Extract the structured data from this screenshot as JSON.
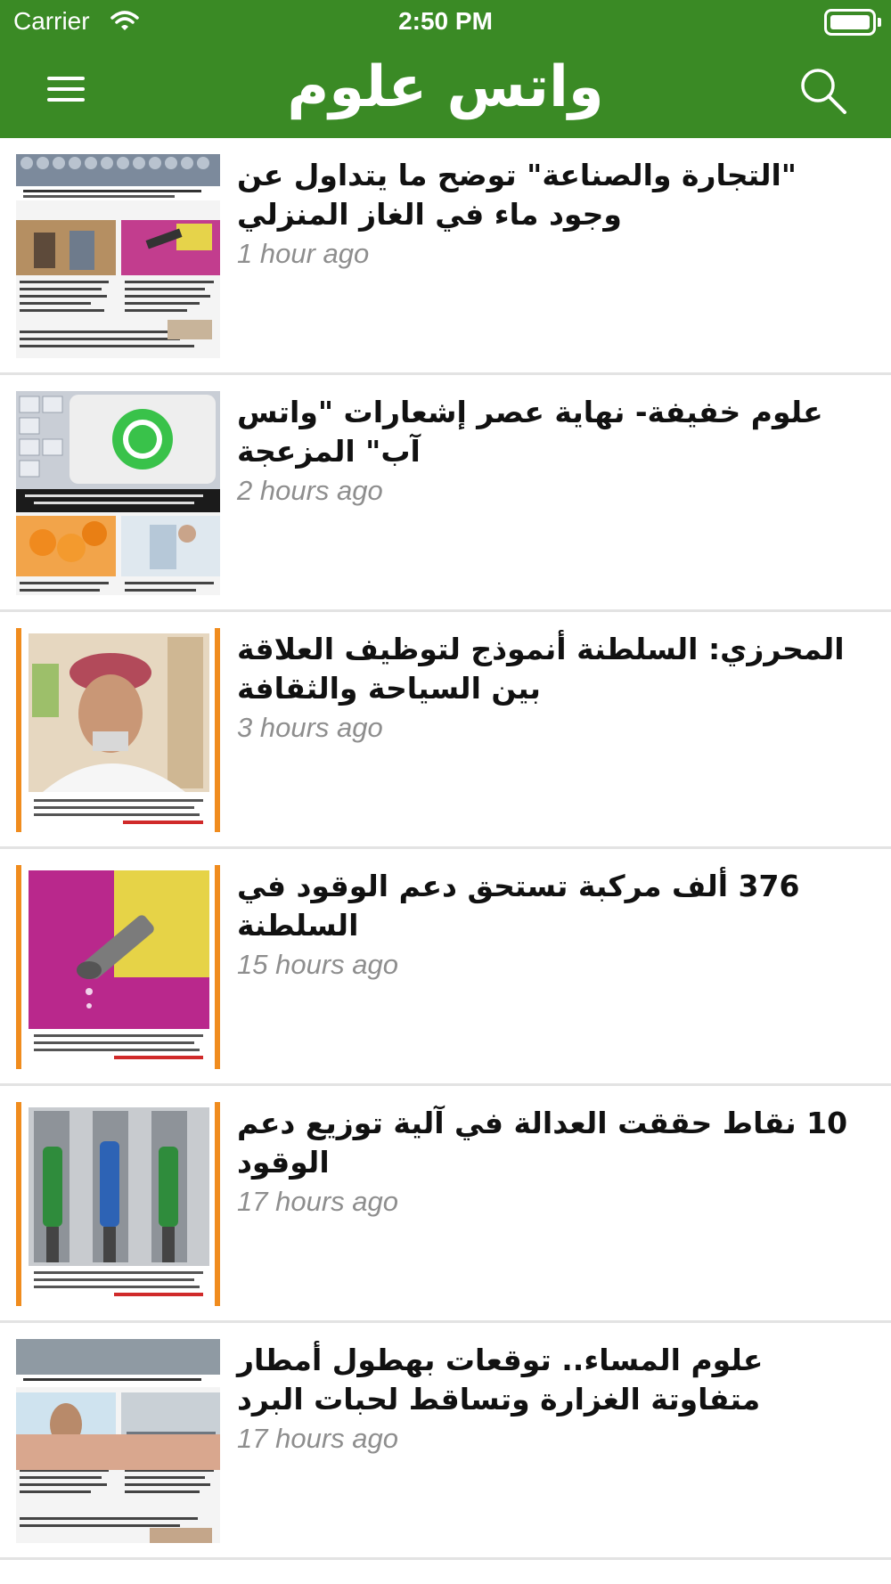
{
  "colors": {
    "header_bg": "#3a8a25",
    "header_fg": "#ffffff",
    "title_text": "#111111",
    "time_text": "#8e8e8e",
    "divider": "#e3e3e3"
  },
  "status_bar": {
    "carrier": "Carrier",
    "time": "2:50 PM",
    "icons": [
      "wifi-icon",
      "battery-icon"
    ]
  },
  "navbar": {
    "title": "واتس علوم",
    "menu_icon": "hamburger-menu-icon",
    "search_icon": "search-icon"
  },
  "news": [
    {
      "title": "\"التجارة والصناعة\" توضح ما يتداول عن وجود ماء في الغاز المنزلي",
      "time": "1 hour ago",
      "thumbnail": "newspaper-clipping-gas-cylinders"
    },
    {
      "title": "علوم خفيفة- نهاية عصر إشعارات \"واتس آب\" المزعجة",
      "time": "2 hours ago",
      "thumbnail": "newspaper-clipping-whatsapp-keyboard"
    },
    {
      "title": "المحرزي: السلطنة أنموذج لتوظيف العلاقة بين السياحة والثقافة",
      "time": "3 hours ago",
      "thumbnail": "newspaper-clipping-man-portrait"
    },
    {
      "title": "376 ألف مركبة تستحق دعم الوقود في السلطنة",
      "time": "15 hours ago",
      "thumbnail": "newspaper-clipping-fuel-nozzle"
    },
    {
      "title": "10 نقاط حققت العدالة في آلية توزيع دعم الوقود",
      "time": "17 hours ago",
      "thumbnail": "newspaper-clipping-fuel-pumps"
    },
    {
      "title": "علوم المساء.. توقعات بهطول أمطار متفاوتة الغزارة وتساقط لحبات البرد",
      "time": "17 hours ago",
      "thumbnail": "newspaper-clipping-rain-road"
    }
  ]
}
